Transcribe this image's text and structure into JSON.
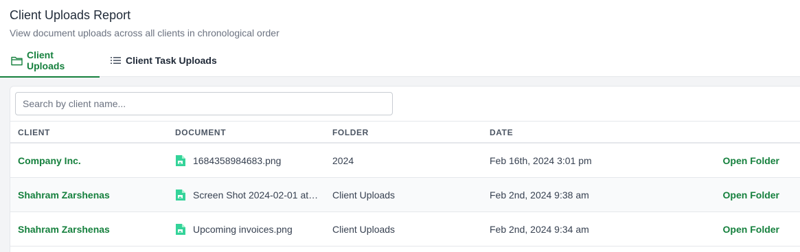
{
  "header": {
    "title": "Client Uploads Report",
    "subtitle": "View document uploads across all clients in chronological order"
  },
  "tabs": [
    {
      "label": "Client Uploads",
      "icon": "folder-icon",
      "active": true
    },
    {
      "label": "Client Task Uploads",
      "icon": "list-icon",
      "active": false
    }
  ],
  "search": {
    "placeholder": "Search by client name...",
    "value": ""
  },
  "table": {
    "columns": [
      "CLIENT",
      "DOCUMENT",
      "FOLDER",
      "DATE"
    ],
    "rows": [
      {
        "client": "Company Inc.",
        "document": "1684358984683.png",
        "folder": "2024",
        "date": "Feb 16th, 2024 3:01 pm",
        "action": "Open Folder"
      },
      {
        "client": "Shahram Zarshenas",
        "document": "Screen Shot 2024-02-01 at …",
        "folder": "Client Uploads",
        "date": "Feb 2nd, 2024 9:38 am",
        "action": "Open Folder"
      },
      {
        "client": "Shahram Zarshenas",
        "document": "Upcoming invoices.png",
        "folder": "Client Uploads",
        "date": "Feb 2nd, 2024 9:34 am",
        "action": "Open Folder"
      }
    ]
  },
  "colors": {
    "accent": "#15803d",
    "file_icon": "#34d399"
  }
}
